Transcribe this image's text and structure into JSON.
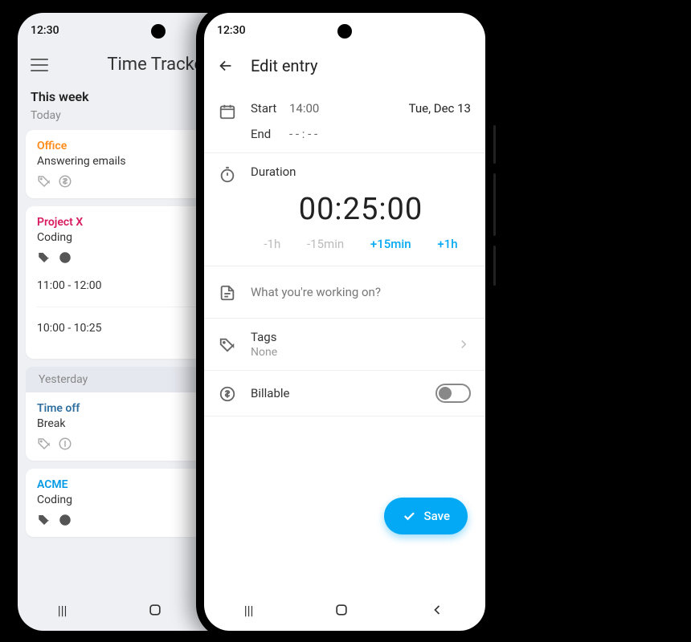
{
  "status_time": "12:30",
  "phone1": {
    "header_title": "Time Tracker",
    "section": "This week",
    "today_label": "Today",
    "yesterday_label": "Yesterday",
    "entries_today": [
      {
        "project": "Office",
        "color": "orange",
        "desc": "Answering emails"
      },
      {
        "project": "Project X",
        "color": "magenta",
        "desc": "Coding"
      }
    ],
    "time_spans": [
      "11:00 - 12:00",
      "10:00 - 10:25"
    ],
    "entries_yesterday": [
      {
        "project": "Time off",
        "color": "blue",
        "desc": "Break"
      },
      {
        "project": "ACME",
        "color": "cyan",
        "desc": "Coding"
      }
    ]
  },
  "phone2": {
    "header_title": "Edit entry",
    "start_label": "Start",
    "start_time": "14:00",
    "date": "Tue, Dec 13",
    "end_label": "End",
    "end_time": "- - : - -",
    "duration_label": "Duration",
    "duration_value": "00:25:00",
    "dur_buttons": {
      "m1h": "-1h",
      "m15": "-15min",
      "p15": "+15min",
      "p1h": "+1h"
    },
    "description_placeholder": "What you're working on?",
    "tags_label": "Tags",
    "tags_value": "None",
    "billable_label": "Billable",
    "save_label": "Save"
  }
}
